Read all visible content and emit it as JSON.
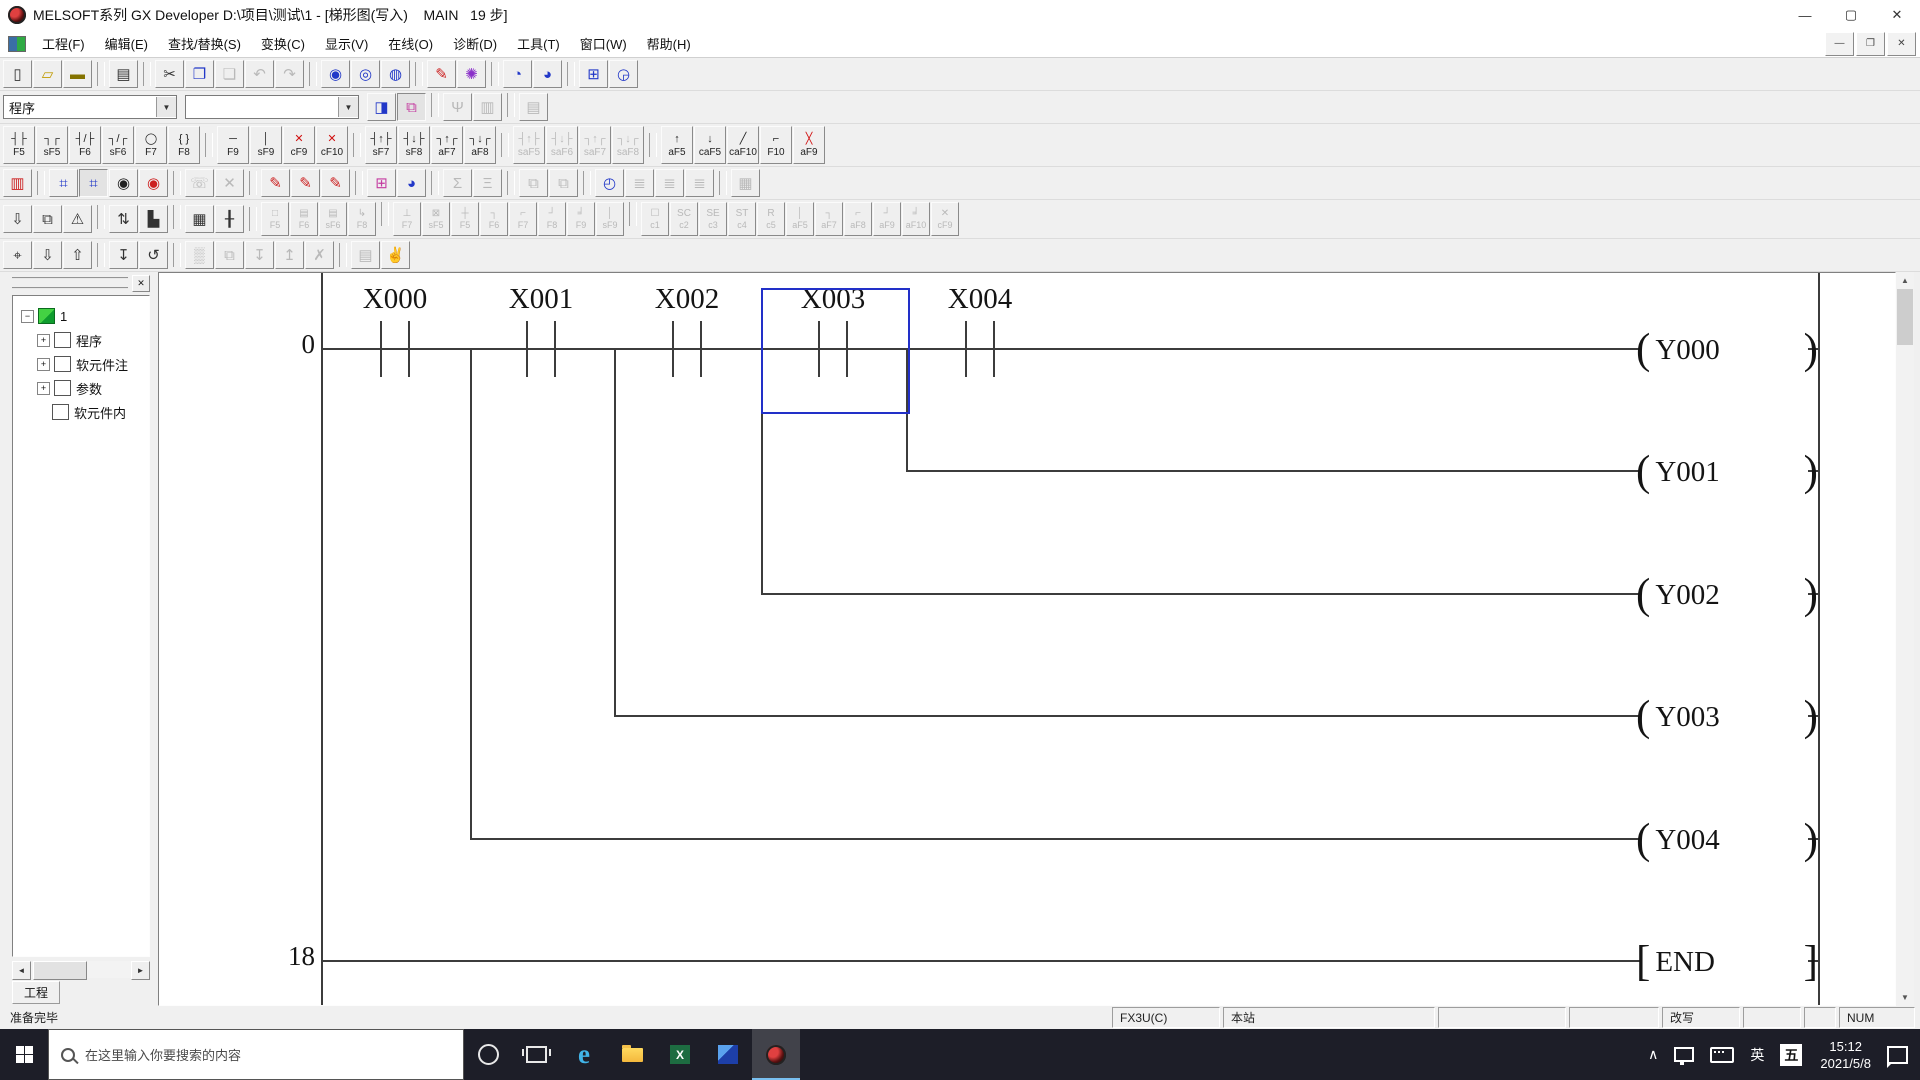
{
  "window": {
    "title": "MELSOFT系列 GX Developer D:\\项目\\测试\\1 - [梯形图(写入)    MAIN   19 步]"
  },
  "icons": {
    "minimize": "—",
    "maximize": "▢",
    "close": "✕",
    "restore": "❐",
    "up": "▲",
    "down": "▼",
    "left": "◄",
    "right": "►",
    "dropdown": "▼",
    "chevron_up": "∧"
  },
  "menu": {
    "items": [
      "工程(F)",
      "编辑(E)",
      "查找/替换(S)",
      "变换(C)",
      "显示(V)",
      "在线(O)",
      "诊断(D)",
      "工具(T)",
      "窗口(W)",
      "帮助(H)"
    ]
  },
  "toolbar1": {
    "buttons": [
      {
        "name": "new-project-button",
        "glyph": "▯"
      },
      {
        "name": "open-project-button",
        "glyph": "▱",
        "cls": "ic-yellow"
      },
      {
        "name": "save-project-button",
        "glyph": "▬",
        "cls": "ic-olive"
      },
      {
        "sep": true
      },
      {
        "name": "print-button",
        "glyph": "▤"
      },
      {
        "sep": true
      },
      {
        "name": "cut-button",
        "glyph": "✂"
      },
      {
        "name": "copy-button",
        "glyph": "❐",
        "cls": "ic-blue"
      },
      {
        "name": "paste-button",
        "glyph": "❏",
        "disabled": true
      },
      {
        "name": "undo-button",
        "glyph": "↶",
        "disabled": true
      },
      {
        "name": "redo-button",
        "glyph": "↷",
        "disabled": true
      },
      {
        "sep": true
      },
      {
        "name": "find-device-button",
        "glyph": "◉",
        "cls": "ic-blue"
      },
      {
        "name": "find-instruction-button",
        "glyph": "◎",
        "cls": "ic-blue"
      },
      {
        "name": "find-string-button",
        "glyph": "◍",
        "cls": "ic-blue"
      },
      {
        "sep": true
      },
      {
        "name": "write-mode-button",
        "glyph": "✎",
        "cls": "ic-red"
      },
      {
        "name": "insert-mode-button",
        "glyph": "✺",
        "cls": "ic-purple"
      },
      {
        "sep": true
      },
      {
        "name": "zoom-out-button",
        "glyph": "◔",
        "cls": "ic-blue"
      },
      {
        "name": "zoom-in-button",
        "glyph": "◕",
        "cls": "ic-blue"
      },
      {
        "sep": true
      },
      {
        "name": "screen-split-button",
        "glyph": "⊞",
        "cls": "ic-blue"
      },
      {
        "name": "comment-display-button",
        "glyph": "◶",
        "cls": "ic-blue"
      }
    ]
  },
  "toolbar2": {
    "program_combo": "程序",
    "find_combo": "",
    "buttons": [
      {
        "name": "find-in-page-button",
        "glyph": "◨",
        "cls": "ic-blue"
      },
      {
        "name": "project-tree-toggle-button",
        "glyph": "⧉",
        "cls": "ic-pink pressed"
      },
      {
        "sep": true
      },
      {
        "name": "parameter-check-button",
        "glyph": "Ψ",
        "disabled": true
      },
      {
        "name": "verify-button",
        "glyph": "▥",
        "disabled": true
      },
      {
        "sep": true
      },
      {
        "name": "data-list-button",
        "glyph": "▤",
        "disabled": true
      }
    ]
  },
  "toolbar3": {
    "tools": [
      {
        "name": "open-contact-tool",
        "sym": "┤├",
        "label": "F5"
      },
      {
        "name": "open-contact-branch-tool",
        "sym": "┐┌",
        "label": "sF5"
      },
      {
        "name": "closed-contact-tool",
        "sym": "┤/├",
        "label": "F6"
      },
      {
        "name": "closed-contact-branch-tool",
        "sym": "┐/┌",
        "label": "sF6"
      },
      {
        "name": "coil-tool",
        "sym": "◯",
        "label": "F7"
      },
      {
        "name": "application-instruction-tool",
        "sym": "{ }",
        "label": "F8"
      },
      {
        "sep": true
      },
      {
        "name": "horizontal-line-tool",
        "sym": "─",
        "label": "F9"
      },
      {
        "name": "vertical-line-tool",
        "sym": "│",
        "label": "sF9"
      },
      {
        "name": "delete-horizontal-line-tool",
        "sym": "✕",
        "label": "cF9",
        "cls": "red-sym"
      },
      {
        "name": "delete-vertical-line-tool",
        "sym": "✕",
        "label": "cF10",
        "cls": "red-sym"
      },
      {
        "sep": true
      },
      {
        "name": "rising-pulse-tool",
        "sym": "┤↑├",
        "label": "sF7"
      },
      {
        "name": "falling-pulse-tool",
        "sym": "┤↓├",
        "label": "sF8"
      },
      {
        "name": "rising-pulse-branch-tool",
        "sym": "┐↑┌",
        "label": "aF7"
      },
      {
        "name": "falling-pulse-branch-tool",
        "sym": "┐↓┌",
        "label": "aF8"
      },
      {
        "sep": true
      },
      {
        "name": "rising-pulse-closed-tool",
        "sym": "┤↑├",
        "label": "saF5",
        "disabled": true
      },
      {
        "name": "falling-pulse-closed-tool",
        "sym": "┤↓├",
        "label": "saF6",
        "disabled": true
      },
      {
        "name": "rising-pulse-closed-branch-tool",
        "sym": "┐↑┌",
        "label": "saF7",
        "disabled": true
      },
      {
        "name": "falling-pulse-closed-branch-tool",
        "sym": "┐↓┌",
        "label": "saF8",
        "disabled": true
      },
      {
        "sep": true
      },
      {
        "name": "invert-operation-tool",
        "sym": "↑",
        "label": "aF5"
      },
      {
        "name": "pulse-operation-tool",
        "sym": "↓",
        "label": "caF5"
      },
      {
        "name": "invert-result-tool",
        "sym": "╱",
        "label": "caF10"
      },
      {
        "name": "line-edit-tool",
        "sym": "⌐",
        "label": "F10"
      },
      {
        "name": "delete-line-tool",
        "sym": "╳",
        "label": "aF9",
        "cls": "red-sym"
      }
    ]
  },
  "toolbar4": {
    "buttons": [
      {
        "name": "ladder-logic-test-button",
        "glyph": "▥",
        "cls": "ic-red"
      },
      {
        "sep": true
      },
      {
        "name": "project-data-list-button",
        "glyph": "⌗",
        "cls": "ic-blue"
      },
      {
        "name": "project-tree-view-button",
        "glyph": "⌗",
        "cls": "ic-blue pressed"
      },
      {
        "name": "device-search-button",
        "glyph": "◉",
        "cls": "ic-dark"
      },
      {
        "name": "device-search-edit-button",
        "glyph": "◉",
        "cls": "ic-red"
      },
      {
        "sep": true
      },
      {
        "name": "remote-operation-button",
        "glyph": "☏",
        "disabled": true
      },
      {
        "name": "interrupt-button",
        "glyph": "✕",
        "disabled": true
      },
      {
        "sep": true
      },
      {
        "name": "device-memory-edit-button",
        "glyph": "✎",
        "cls": "ic-red"
      },
      {
        "name": "device-comment-edit-button",
        "glyph": "✎",
        "cls": "ic-red"
      },
      {
        "name": "device-init-edit-button",
        "glyph": "✎",
        "cls": "ic-red"
      },
      {
        "sep": true
      },
      {
        "name": "tile-windows-button",
        "glyph": "⊞",
        "cls": "ic-pink"
      },
      {
        "name": "monitor-zoom-button",
        "glyph": "◕",
        "cls": "ic-blue"
      },
      {
        "sep": true
      },
      {
        "name": "step-execution-button",
        "glyph": "Σ",
        "disabled": true
      },
      {
        "name": "partial-execution-button",
        "glyph": "Ξ",
        "disabled": true
      },
      {
        "sep": true
      },
      {
        "name": "cascade-windows-button",
        "glyph": "⧉",
        "disabled": true
      },
      {
        "name": "arrange-windows-button",
        "glyph": "⧉",
        "disabled": true
      },
      {
        "sep": true
      },
      {
        "name": "trace-monitor-button",
        "glyph": "◴",
        "cls": "ic-blue"
      },
      {
        "name": "sampling-trace-1-button",
        "glyph": "≣",
        "disabled": true
      },
      {
        "name": "sampling-trace-2-button",
        "glyph": "≣",
        "disabled": true
      },
      {
        "name": "sampling-trace-3-button",
        "glyph": "≣",
        "disabled": true
      },
      {
        "sep": true
      },
      {
        "name": "full-screen-button",
        "glyph": "▦",
        "disabled": true
      }
    ]
  },
  "toolbar5": {
    "left_buttons": [
      {
        "name": "sfc-block-conversion-button",
        "glyph": "⇩"
      },
      {
        "name": "sfc-block-copy-button",
        "glyph": "⧉"
      },
      {
        "name": "sfc-error-check-button",
        "glyph": "⚠"
      },
      {
        "sep": true
      },
      {
        "name": "sfc-sort-button",
        "glyph": "⇅"
      },
      {
        "name": "sfc-block-list-button",
        "glyph": "▙"
      },
      {
        "sep": true
      },
      {
        "name": "sfc-grid-button",
        "glyph": "▦"
      },
      {
        "name": "sfc-step-attribute-button",
        "glyph": "╂"
      }
    ],
    "tools": [
      {
        "name": "sfc-step-tool",
        "sym": "□",
        "label": "F5",
        "disabled": true
      },
      {
        "name": "sfc-dual-step-tool",
        "sym": "▤",
        "label": "F6",
        "disabled": true
      },
      {
        "name": "sfc-block-step-tool",
        "sym": "▤",
        "label": "sF6",
        "disabled": true
      },
      {
        "name": "sfc-jump-tool",
        "sym": "↳",
        "label": "F8",
        "disabled": true
      },
      {
        "sep": true
      },
      {
        "name": "sfc-end-step-tool",
        "sym": "⊥",
        "label": "F7",
        "disabled": true
      },
      {
        "name": "sfc-dummy-step-tool",
        "sym": "⊠",
        "label": "sF5",
        "disabled": true
      },
      {
        "name": "sfc-transition-tool",
        "sym": "┼",
        "label": "F5",
        "disabled": true
      },
      {
        "name": "sfc-selection-divergence-tool",
        "sym": "┐",
        "label": "F6",
        "disabled": true
      },
      {
        "name": "sfc-simultaneous-divergence-tool",
        "sym": "⌐",
        "label": "F7",
        "disabled": true
      },
      {
        "name": "sfc-selection-convergence-tool",
        "sym": "┘",
        "label": "F8",
        "disabled": true
      },
      {
        "name": "sfc-simultaneous-convergence-tool",
        "sym": "╛",
        "label": "F9",
        "disabled": true
      },
      {
        "name": "sfc-vertical-line-tool",
        "sym": "│",
        "label": "sF9",
        "disabled": true
      },
      {
        "sep": true
      },
      {
        "name": "sfc-comment-tool",
        "sym": "☐",
        "label": "c1",
        "disabled": true
      },
      {
        "name": "sfc-sc-attribute-tool",
        "sym": "SC",
        "label": "c2",
        "disabled": true
      },
      {
        "name": "sfc-se-attribute-tool",
        "sym": "SE",
        "label": "c3",
        "disabled": true
      },
      {
        "name": "sfc-st-attribute-tool",
        "sym": "ST",
        "label": "c4",
        "disabled": true
      },
      {
        "name": "sfc-r-attribute-tool",
        "sym": "R",
        "label": "c5",
        "disabled": true
      },
      {
        "name": "sfc-delete-vertical-tool",
        "sym": "│",
        "label": "aF5",
        "disabled": true
      },
      {
        "name": "sfc-delete-sel-div-tool",
        "sym": "┐",
        "label": "aF7",
        "disabled": true
      },
      {
        "name": "sfc-delete-sim-div-tool",
        "sym": "⌐",
        "label": "aF8",
        "disabled": true
      },
      {
        "name": "sfc-delete-sel-conv-tool",
        "sym": "┘",
        "label": "aF9",
        "disabled": true
      },
      {
        "name": "sfc-delete-sim-conv-tool",
        "sym": "╛",
        "label": "aF10",
        "disabled": true
      },
      {
        "name": "sfc-delete-line-tool",
        "sym": "✕",
        "label": "cF9",
        "disabled": true
      }
    ]
  },
  "toolbar6": {
    "buttons": [
      {
        "name": "find-binoculars-button",
        "glyph": "⌖"
      },
      {
        "name": "find-next-button",
        "glyph": "⇩"
      },
      {
        "name": "find-previous-button",
        "glyph": "⇧"
      },
      {
        "sep": true
      },
      {
        "name": "jump-to-step-button",
        "glyph": "↧"
      },
      {
        "name": "recall-search-button",
        "glyph": "↺"
      },
      {
        "sep": true
      },
      {
        "name": "select-range-button",
        "glyph": "▒",
        "disabled": true
      },
      {
        "name": "window-layers-button",
        "glyph": "⧉",
        "disabled": true
      },
      {
        "name": "register-windows-button",
        "glyph": "↧",
        "disabled": true
      },
      {
        "name": "restore-windows-button",
        "glyph": "↥",
        "disabled": true
      },
      {
        "name": "delete-registration-button",
        "glyph": "✗",
        "disabled": true
      },
      {
        "sep": true
      },
      {
        "name": "print-preview-button",
        "glyph": "▤",
        "disabled": true
      },
      {
        "name": "pan-hand-button",
        "glyph": "✌",
        "disabled": true
      }
    ]
  },
  "tree": {
    "root_label": "1",
    "items": [
      {
        "expand": "+",
        "label": "程序",
        "cls": "it-prog"
      },
      {
        "expand": "+",
        "label": "软元件注",
        "cls": "it-com"
      },
      {
        "expand": "+",
        "label": "参数",
        "cls": "it-par"
      },
      {
        "expand": "",
        "label": "软元件内",
        "cls": "it-mem"
      }
    ],
    "tab_label": "工程"
  },
  "ladder": {
    "step_first": "0",
    "step_end": "18",
    "contacts": [
      "X000",
      "X001",
      "X002",
      "X003",
      "X004"
    ],
    "coils": [
      "Y000",
      "Y001",
      "Y002",
      "Y003",
      "Y004"
    ],
    "end_label": "END",
    "colors": {
      "wire": "#3c3c3c",
      "cursor": "#2230c8"
    }
  },
  "statusbar": {
    "ready": "准备完毕",
    "plc_type": "FX3U(C)",
    "station": "本站",
    "mode": "改写",
    "num_lock": "NUM"
  },
  "taskbar": {
    "search_placeholder": "在这里输入你要搜索的内容",
    "lang_a": "英",
    "lang_b": "五",
    "time": "15:12",
    "date": "2021/5/8"
  }
}
